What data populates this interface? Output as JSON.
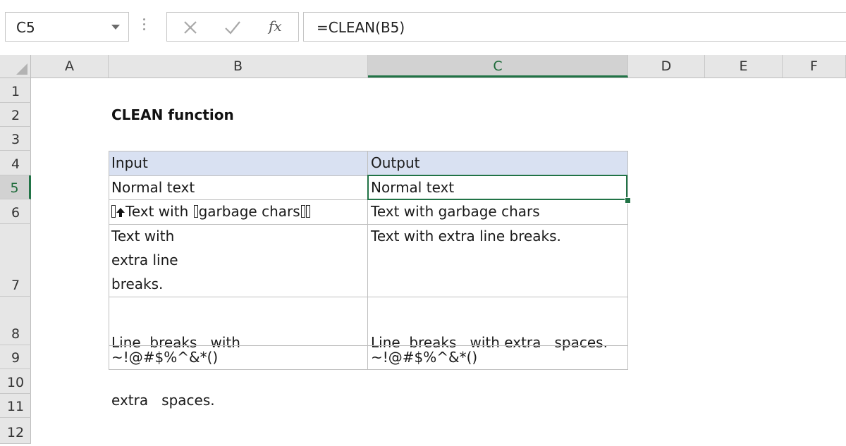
{
  "formula_bar": {
    "name_box": "C5",
    "cancel_icon": "close-icon",
    "enter_icon": "checkmark-icon",
    "fx_label": "fx",
    "formula": "=CLEAN(B5)"
  },
  "columns": [
    "A",
    "B",
    "C",
    "D",
    "E",
    "F"
  ],
  "selected_column": "C",
  "rows": [
    "1",
    "2",
    "3",
    "4",
    "5",
    "6",
    "7",
    "8",
    "9",
    "10",
    "11",
    "12"
  ],
  "selected_row": "5",
  "sheet": {
    "title": "CLEAN function",
    "table_headers": {
      "input": "Input",
      "output": "Output"
    },
    "table_rows": [
      {
        "input": [
          "Normal text"
        ],
        "output": [
          "Normal text"
        ]
      },
      {
        "input": [
          "",
          "Text with ",
          "garbage chars",
          ""
        ],
        "output": [
          "Text with garbage chars"
        ]
      },
      {
        "input": [
          "Text with",
          "extra line",
          "breaks."
        ],
        "output": [
          "Text with extra line breaks."
        ]
      },
      {
        "input": [
          "Line  breaks   with",
          "extra   spaces."
        ],
        "output": [
          "Line  breaks   with extra   spaces."
        ]
      },
      {
        "input": [
          "~!@#$%^&*()"
        ],
        "output": [
          "~!@#$%^&*()"
        ]
      }
    ]
  },
  "colors": {
    "accent": "#217346",
    "table_header_fill": "#d9e1f2",
    "header_background": "#e6e6e6"
  }
}
